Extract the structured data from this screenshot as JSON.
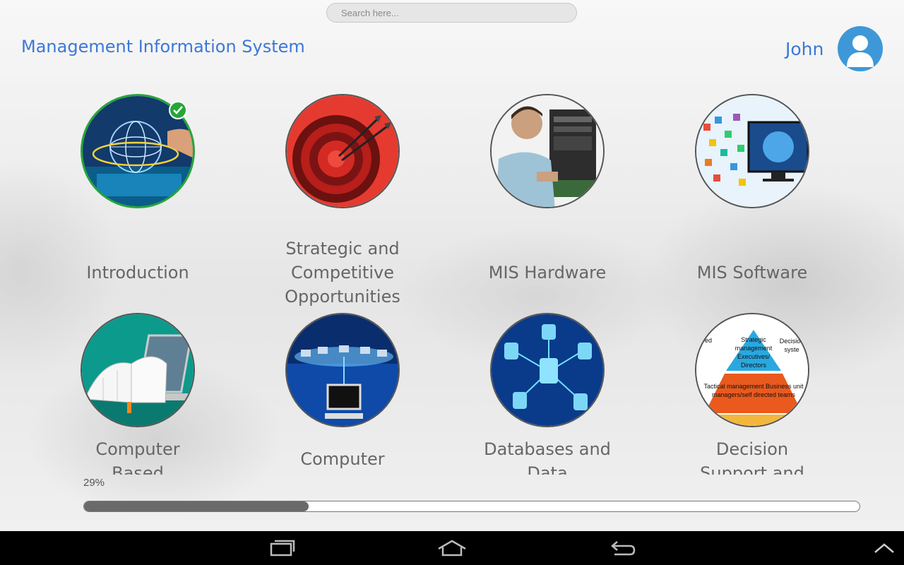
{
  "search": {
    "placeholder": "Search here..."
  },
  "header": {
    "title": "Management Information System",
    "user_name": "John"
  },
  "topics": [
    {
      "label": "Introduction",
      "completed": true,
      "icon": "globe-hand-icon"
    },
    {
      "label": "Strategic and Competitive Opportunities",
      "completed": false,
      "icon": "target-dart-icon"
    },
    {
      "label": "MIS Hardware",
      "completed": false,
      "icon": "technician-computer-icon"
    },
    {
      "label": "MIS Software",
      "completed": false,
      "icon": "software-apps-monitor-icon"
    },
    {
      "label": "Computer Based",
      "completed": false,
      "icon": "book-laptop-icon"
    },
    {
      "label": "Computer",
      "completed": false,
      "icon": "network-computer-icon"
    },
    {
      "label": "Databases and Data",
      "completed": false,
      "icon": "database-network-icon"
    },
    {
      "label": "Decision Support and",
      "completed": false,
      "icon": "management-pyramid-icon"
    }
  ],
  "pyramid": {
    "top": "Strategic management Executives/ Directors",
    "middle": "Tactical management Business unit managers/self directed teams",
    "left_fragment": "ured",
    "right_fragment": "Decision syste"
  },
  "progress": {
    "label": "29%",
    "percent": 29
  },
  "colors": {
    "accent": "#3c78d8",
    "completed_ring": "#27a53a",
    "progress_fill": "#6a6a6a"
  },
  "navbar": [
    "recent-apps-icon",
    "home-icon",
    "back-icon",
    "chevron-up-icon"
  ]
}
